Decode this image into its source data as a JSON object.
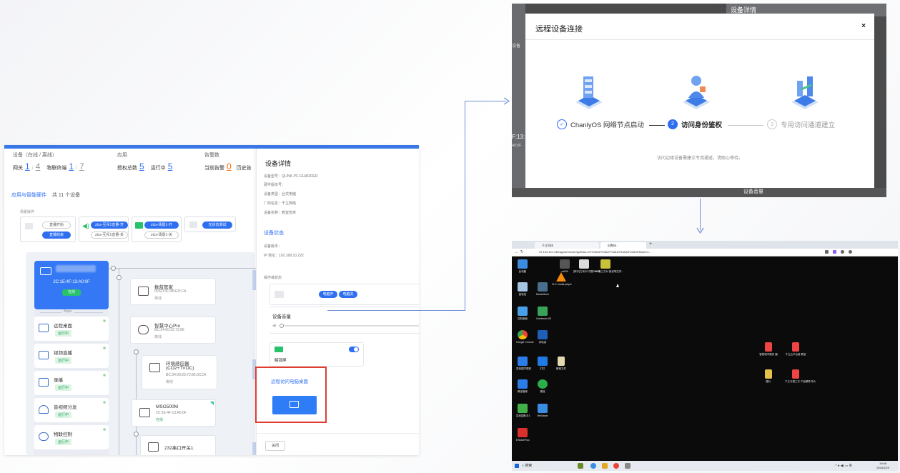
{
  "dashboard": {
    "stats": [
      {
        "title": "设备（在线 / 离线）",
        "items": [
          {
            "label": "网关",
            "a": "1",
            "sep": "/",
            "b": "4"
          },
          {
            "label": "物联终端",
            "a": "1",
            "sep": "/",
            "b": "7"
          }
        ]
      },
      {
        "title": "应用",
        "items": [
          {
            "label": "授权总数",
            "a": "5"
          },
          {
            "label": "运行中",
            "a": "5"
          }
        ]
      },
      {
        "title": "告警数",
        "items": [
          {
            "label": "当前告警",
            "a": "0"
          },
          {
            "label": "历史告"
          }
        ]
      }
    ],
    "section": {
      "title": "应用与智能硬件",
      "count": "共 11 个设备"
    },
    "scene_label": "场景操作",
    "scenes": [
      {
        "buttons": [
          "直播开始",
          "直播结束"
        ]
      },
      {
        "buttons": [
          "ztcs-互斥1音量-开",
          "ztcs-互斥1音量-关"
        ]
      },
      {
        "buttons": [
          "ztcs-场景1-开",
          "ztcs-场景1-关"
        ]
      },
      {
        "buttons": [
          "无状态测试"
        ]
      }
    ],
    "gateway": {
      "mac": "2C:1E:4F:13:A0:0F",
      "status": "在线"
    },
    "apps_label": "Apps",
    "apps": [
      {
        "name": "远程桌面",
        "status": "运行中"
      },
      {
        "name": "视频直播",
        "status": "运行中"
      },
      {
        "name": "录播",
        "status": "运行中"
      },
      {
        "name": "音视频分发",
        "status": "运行中"
      },
      {
        "name": "物联控制",
        "status": "运行中"
      }
    ],
    "devices": [
      {
        "name": "数蓝管家",
        "mac": "00:E0:0C:85:ED:CA",
        "status": "离线"
      },
      {
        "name": "智慧中心Pro",
        "mac": "BC:34:00:23:72:86",
        "status": "离线"
      },
      {
        "name": "环境感应器",
        "name2": "(CO2+TVOC)",
        "mac": "BC:34:00:23:72:86:3CCA",
        "status": "离线"
      },
      {
        "name": "MSG500M",
        "mac": "2C:1E:4F:13:A0:0F",
        "status": "在线"
      },
      {
        "name": "232串口开关1"
      }
    ]
  },
  "detail": {
    "title": "设备详情",
    "info": [
      "设备型号：QLINK-PC-GUARDER",
      "硬件版本号：",
      "设备类型：台式电脑",
      "厂商信息：千立网络",
      "设备名称：教室管家"
    ],
    "status_title": "设备状态",
    "status_info": [
      "设备版本：",
      "IP 地址：192.168.10.222"
    ],
    "op_label": "操作或状态",
    "power_on": "电脑开",
    "power_off": "电脑关",
    "volume_label": "设备音量",
    "unlock_label": "解锁屏",
    "remote_title": "远程访问电脑桌面",
    "close": "关闭"
  },
  "modal": {
    "bg_title": "设备详情",
    "bg_volume": "设备音量",
    "bg_left": "设备",
    "bg_mac": "F:13:",
    "bg_mac2": "A0:0F",
    "title": "远程设备连接",
    "close": "×",
    "steps": [
      {
        "index": "✓",
        "label": "ChanlyOS 网络节点启动"
      },
      {
        "index": "2",
        "label": "访问身份鉴权"
      },
      {
        "index": "3",
        "label": "专用访问通道建立"
      }
    ],
    "tip": "访问边缘设备需建立专用通道，请耐心等待。"
  },
  "desktop": {
    "tabs": [
      "千立科技",
      "旧数码..."
    ],
    "url": "47.103.110.135/apps/remote?guiMac=2C%3A1E%3A4F%3A13%3AA0%3A0F&token=...",
    "icons_left": [
      "此电脑",
      "回收站",
      "控制面板",
      "Google Chrome",
      "易校园学课堂",
      "教室管家",
      "易校园助手1",
      "EShareProc"
    ],
    "icons_col2": [
      "MobaXterm",
      "Camtasia MS",
      "米哈游",
      "钉钉",
      "微信",
      "WeGame"
    ],
    "icons_top": [
      "vd169",
      "[阿尔]力系列 中国20115...",
      "IM 第三方对 接说明文件..."
    ],
    "vlc": "VLC media player",
    "right_files": [
      "智慧城市服务 器",
      "千立云平台接 教室",
      "图片",
      "千立与第三方 产品硬件评价"
    ],
    "file_mid": "教程文件",
    "search": "搜索",
    "time": "19:06",
    "date": "2024/2/29",
    "ime": "英"
  }
}
